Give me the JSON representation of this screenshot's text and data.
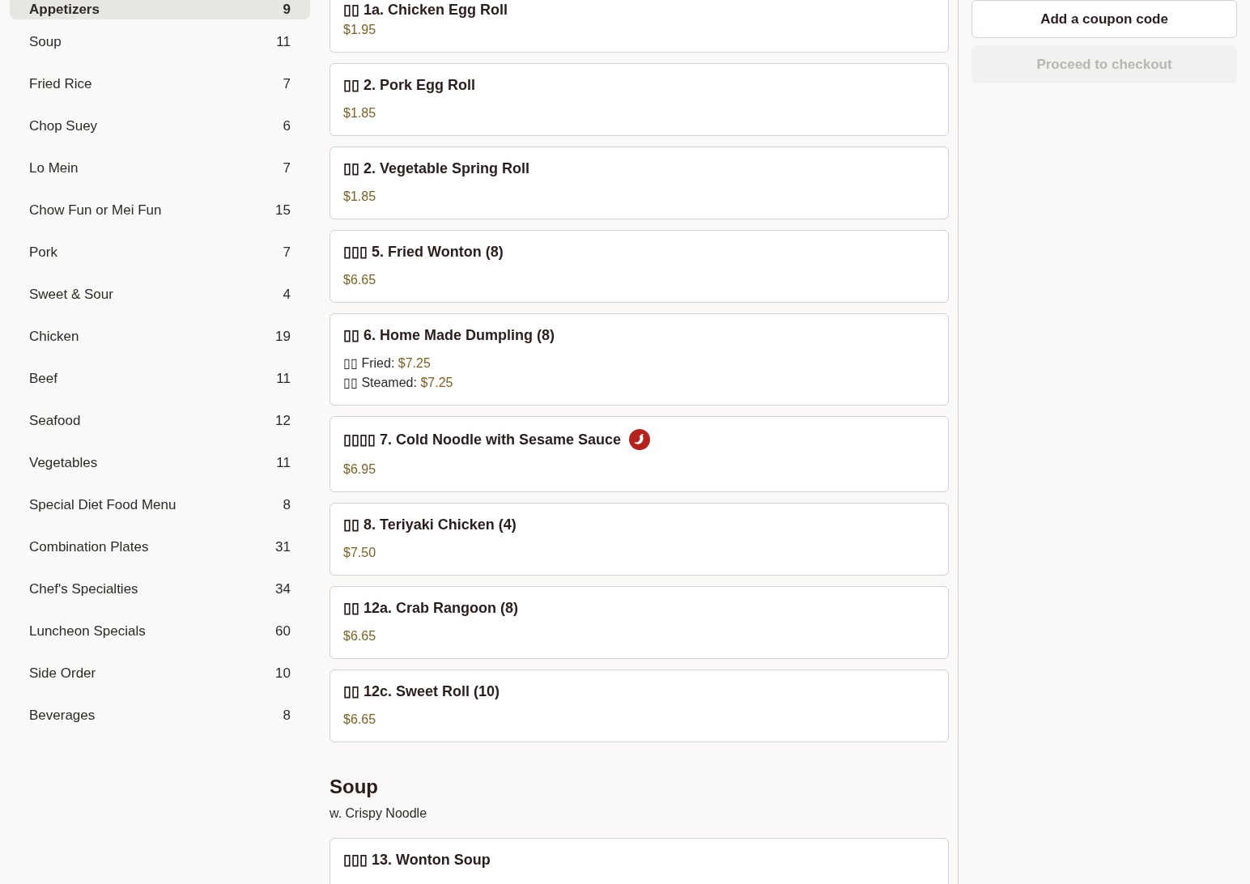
{
  "sidebar": {
    "categories": [
      {
        "name": "Appetizers",
        "count": "9",
        "selected": true
      },
      {
        "name": "Soup",
        "count": "11",
        "selected": false
      },
      {
        "name": "Fried Rice",
        "count": "7",
        "selected": false
      },
      {
        "name": "Chop Suey",
        "count": "6",
        "selected": false
      },
      {
        "name": "Lo Mein",
        "count": "7",
        "selected": false
      },
      {
        "name": "Chow Fun or Mei Fun",
        "count": "15",
        "selected": false
      },
      {
        "name": "Pork",
        "count": "7",
        "selected": false
      },
      {
        "name": "Sweet & Sour",
        "count": "4",
        "selected": false
      },
      {
        "name": "Chicken",
        "count": "19",
        "selected": false
      },
      {
        "name": "Beef",
        "count": "11",
        "selected": false
      },
      {
        "name": "Seafood",
        "count": "12",
        "selected": false
      },
      {
        "name": "Vegetables",
        "count": "11",
        "selected": false
      },
      {
        "name": "Special Diet Food Menu",
        "count": "8",
        "selected": false
      },
      {
        "name": "Combination Plates",
        "count": "31",
        "selected": false
      },
      {
        "name": "Chef's Specialties",
        "count": "34",
        "selected": false
      },
      {
        "name": "Luncheon Specials",
        "count": "60",
        "selected": false
      },
      {
        "name": "Side Order",
        "count": "10",
        "selected": false
      },
      {
        "name": "Beverages",
        "count": "8",
        "selected": false
      }
    ]
  },
  "menu": {
    "sections": [
      {
        "items": [
          {
            "name": "▯▯ 1a. Chicken Egg Roll",
            "spicy": false,
            "kind": "single",
            "price": "$1.95"
          },
          {
            "name": "▯▯ 2. Pork Egg Roll",
            "spicy": false,
            "kind": "single",
            "price": "$1.85"
          },
          {
            "name": "▯▯ 2. Vegetable Spring Roll",
            "spicy": false,
            "kind": "single",
            "price": "$1.85"
          },
          {
            "name": "▯▯▯ 5. Fried Wonton (8)",
            "spicy": false,
            "kind": "single",
            "price": "$6.65"
          },
          {
            "name": "▯▯ 6. Home Made Dumpling (8)",
            "spicy": false,
            "kind": "options",
            "options": [
              {
                "label": "▯▯ Fried:",
                "price": "$7.25"
              },
              {
                "label": "▯▯ Steamed:",
                "price": "$7.25"
              }
            ]
          },
          {
            "name": "▯▯▯▯ 7. Cold Noodle with Sesame Sauce",
            "spicy": true,
            "kind": "single",
            "price": "$6.95"
          },
          {
            "name": "▯▯ 8. Teriyaki Chicken (4)",
            "spicy": false,
            "kind": "single",
            "price": "$7.50"
          },
          {
            "name": "▯▯ 12a. Crab Rangoon (8)",
            "spicy": false,
            "kind": "single",
            "price": "$6.65"
          },
          {
            "name": "▯▯ 12c. Sweet Roll (10)",
            "spicy": false,
            "kind": "single",
            "price": "$6.65"
          }
        ]
      },
      {
        "title": "Soup",
        "description": "w. Crispy Noodle",
        "items": [
          {
            "name": "▯▯▯ 13. Wonton Soup",
            "spicy": false,
            "kind": "cut"
          }
        ]
      }
    ]
  },
  "cart": {
    "buttons": [
      {
        "label": "Add a coupon code",
        "disabled": false
      },
      {
        "label": "Proceed to checkout",
        "disabled": true
      }
    ]
  }
}
